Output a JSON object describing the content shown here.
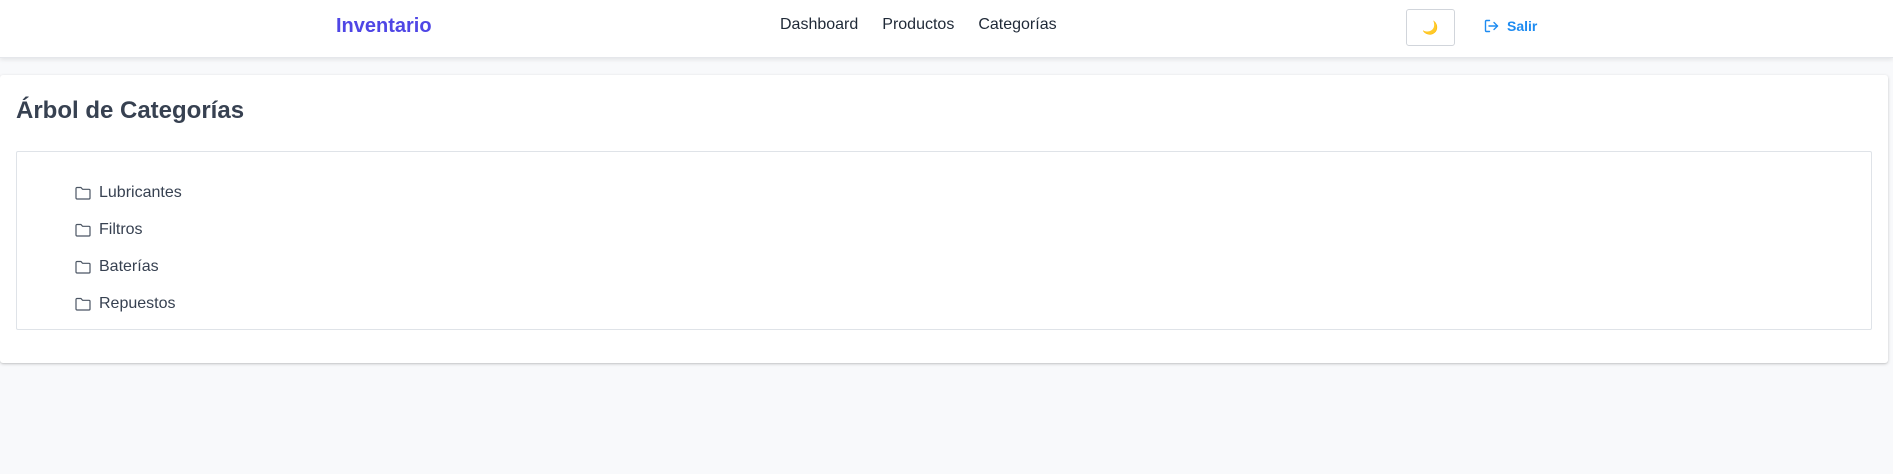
{
  "navbar": {
    "brand": "Inventario",
    "links": [
      {
        "label": "Dashboard"
      },
      {
        "label": "Productos"
      },
      {
        "label": "Categorías"
      }
    ],
    "theme_toggle_icon": "moon-icon",
    "logout_label": "Salir",
    "logout_icon": "sign-out-icon"
  },
  "page": {
    "title": "Árbol de Categorías"
  },
  "tree": {
    "items": [
      {
        "label": "Lubricantes",
        "icon": "folder-icon"
      },
      {
        "label": "Filtros",
        "icon": "folder-icon"
      },
      {
        "label": "Baterías",
        "icon": "folder-icon"
      },
      {
        "label": "Repuestos",
        "icon": "folder-icon"
      }
    ]
  },
  "colors": {
    "brand": "#4f46e5",
    "link_blue": "#1d8bf1",
    "background": "#f8f9fb"
  }
}
